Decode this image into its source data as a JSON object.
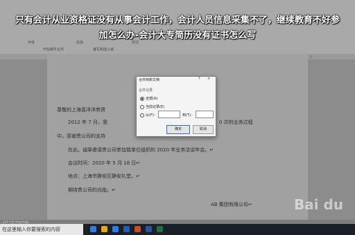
{
  "banner": {
    "line1": "只有会计从业资格证没有从事会计工作，会计人员信息采集不了，继续教育不好参",
    "line2": "加怎么办-会计大专简历没有证书怎么写"
  },
  "ribbon": {
    "groups": [
      "字体",
      "段落",
      "样式",
      "开始邮件合并",
      "编写和插入域"
    ]
  },
  "document": {
    "lines": [
      "尊敬的上海喜洋洋恭贺",
      "2012 年 7 月，我",
      "0 次的业务过程",
      "中，感谢贵公司的支持",
      "在此，诚挚邀请贵公司参加我单位组织的 2020 年业务洽谈年会。↵",
      "会议时间：2020 年 5 月 18 日↵",
      "地点：上海市静安区静安礼堂。↵",
      "期待贵公司的光临。↵",
      "AB 集团有限公司↵"
    ]
  },
  "dialog": {
    "title": "合并到新文档",
    "help_glyph": "?",
    "close_glyph": "×",
    "group_label": "合并记录",
    "options": [
      "全部(A)",
      "当前记录(E)",
      "从(F):"
    ],
    "to_label": "到(T):",
    "ok_label": "确定",
    "cancel_label": "取消"
  },
  "statusbar": {
    "text": "127 个字  中文(中国)"
  },
  "taskbar": {
    "search_placeholder": "在这里输入你要搜索的内容"
  },
  "watermark": {
    "text": "Bai du"
  },
  "colors": {
    "accent_blue": "#2d6bd3",
    "taskbar": "#1b1f27"
  }
}
